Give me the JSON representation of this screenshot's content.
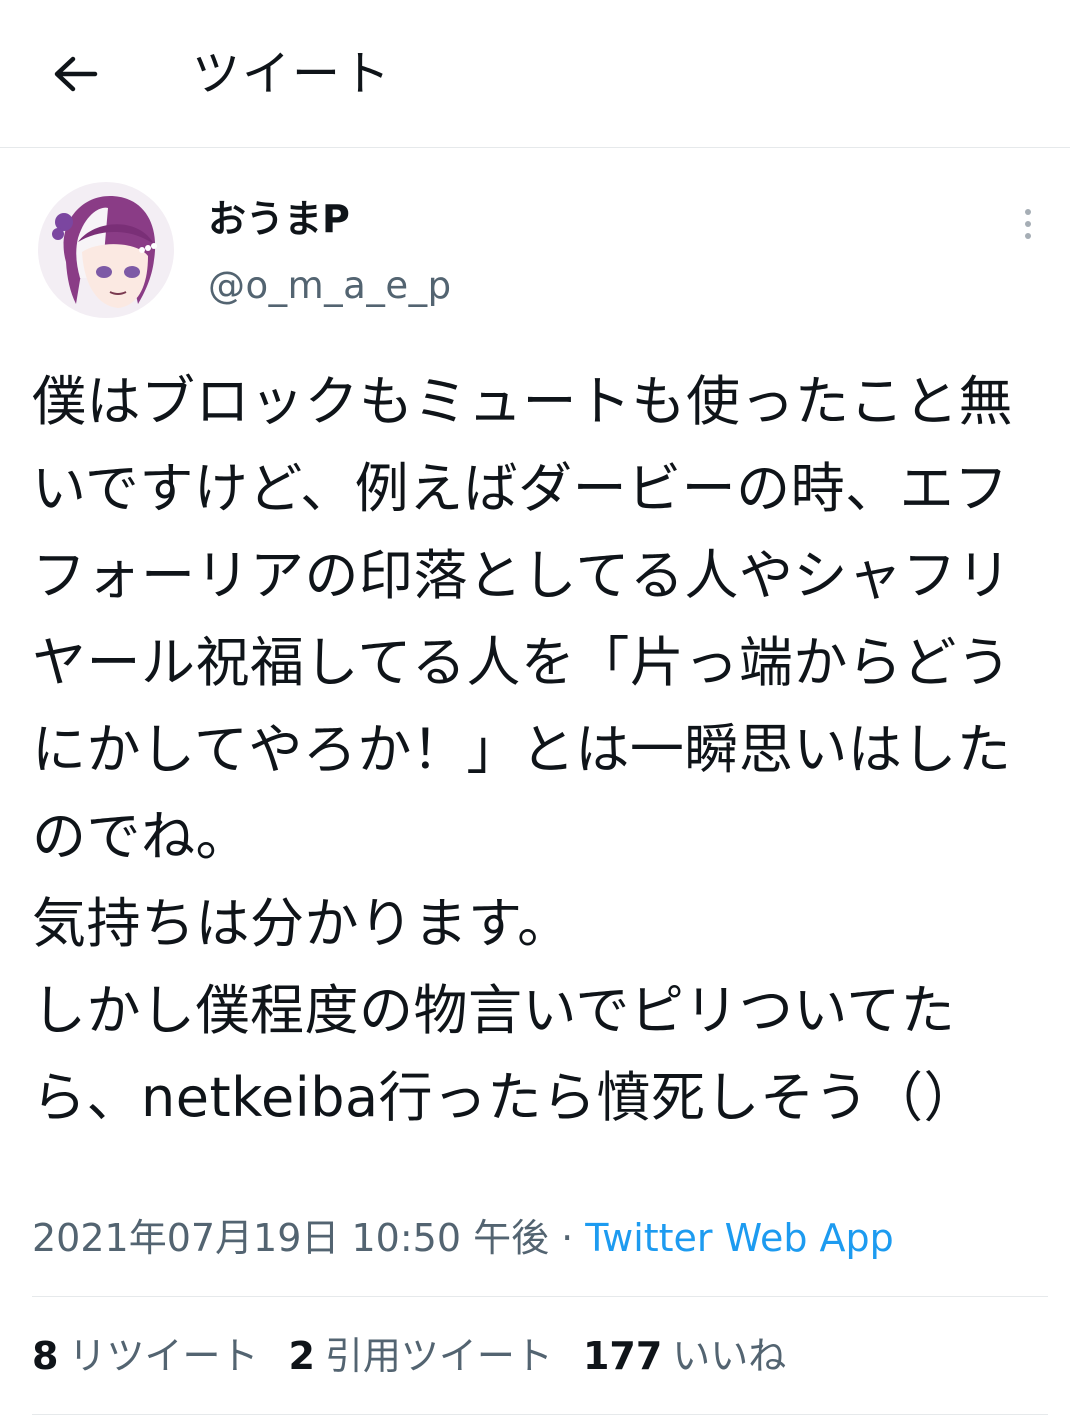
{
  "header": {
    "title": "ツイート",
    "back_icon": "arrow-left-icon"
  },
  "author": {
    "display_name": "おうまP",
    "handle": "@o_m_a_e_p",
    "avatar": "avatar-illustration"
  },
  "tweet": {
    "text": "僕はブロックもミュートも使ったこと無いですけど、例えばダービーの時、エフフォーリアの印落としてる人やシャフリヤール祝福してる人を「片っ端からどうにかしてやろか！」とは一瞬思いはしたのでね。\n気持ちは分かります。\nしかし僕程度の物言いでピリついてたら、netkeiba行ったら憤死しそう（）",
    "timestamp": "2021年07月19日 10:50 午後",
    "separator": "·",
    "source": "Twitter Web App"
  },
  "stats": {
    "retweets": {
      "count": "8",
      "label": "リツイート"
    },
    "quotes": {
      "count": "2",
      "label": "引用ツイート"
    },
    "likes": {
      "count": "177",
      "label": "いいね"
    }
  },
  "colors": {
    "text": "#0f1419",
    "secondary": "#536471",
    "link": "#1d9bf0",
    "border": "#e6e9eb"
  }
}
